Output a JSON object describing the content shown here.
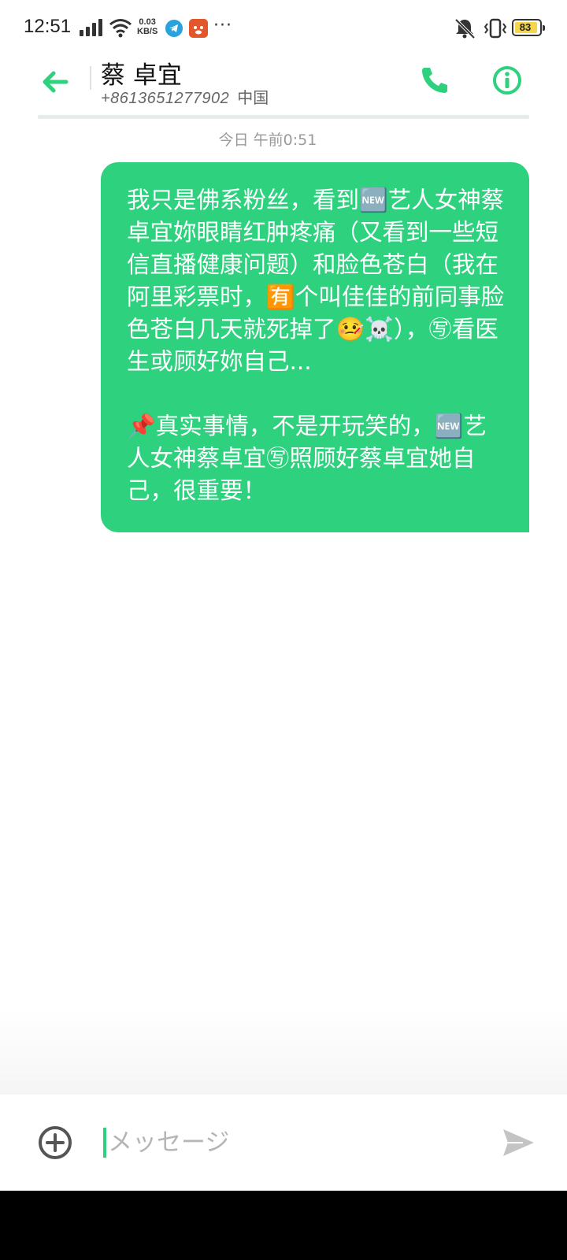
{
  "status_bar": {
    "time": "12:51",
    "net_speed_value": "0.03",
    "net_speed_unit": "KB/S",
    "more": "···",
    "battery": "83"
  },
  "header": {
    "contact_name": "蔡 卓宜",
    "phone_number": "+8613651277902",
    "country": "中国"
  },
  "chat": {
    "timestamp": "今日 午前0:51",
    "messages": [
      {
        "direction": "outgoing",
        "text": "我只是佛系粉丝，看到🆕艺人女神蔡卓宜妳眼睛红肿疼痛（又看到一些短信直播健康问题）和脸色苍白（我在阿里彩票时，🈶个叫佳佳的前同事脸色苍白几天就死掉了🤒☠️），㊢看医生或顾好妳自己...\n\n📌真实事情，不是开玩笑的，🆕艺人女神蔡卓宜㊢照顾好蔡卓宜她自己，很重要！"
      }
    ]
  },
  "composer": {
    "placeholder": "メッセージ"
  },
  "colors": {
    "accent": "#2dd17e",
    "bubble_text": "#ffffff",
    "timestamp": "#9a9a9a",
    "icon_gray": "#555555"
  }
}
